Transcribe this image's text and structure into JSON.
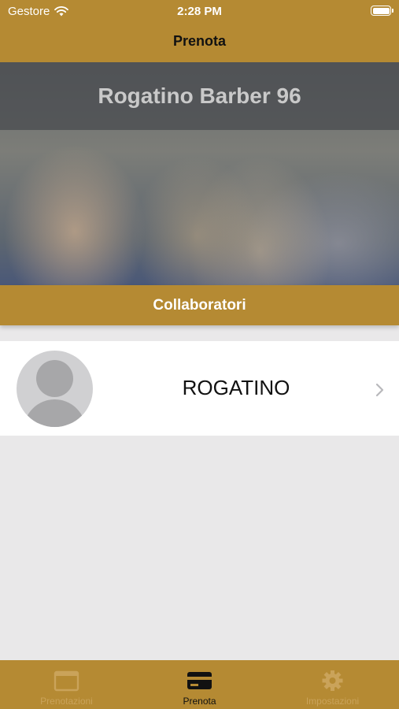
{
  "status_bar": {
    "carrier": "Gestore",
    "time": "2:28 PM"
  },
  "nav": {
    "title": "Prenota"
  },
  "hero": {
    "title": "Rogatino Barber 96"
  },
  "section": {
    "title": "Collaboratori"
  },
  "collaborators": [
    {
      "name": "ROGATINO",
      "avatar": "person-placeholder-icon"
    }
  ],
  "tabs": [
    {
      "label": "Prenotazioni",
      "icon": "calendar-icon",
      "active": false
    },
    {
      "label": "Prenota",
      "icon": "card-icon",
      "active": true
    },
    {
      "label": "Impostazioni",
      "icon": "gear-icon",
      "active": false
    }
  ],
  "colors": {
    "accent": "#b58a33",
    "background": "#e9e8e9",
    "active_tab": "#111111",
    "inactive_tab": "#caa35a"
  }
}
